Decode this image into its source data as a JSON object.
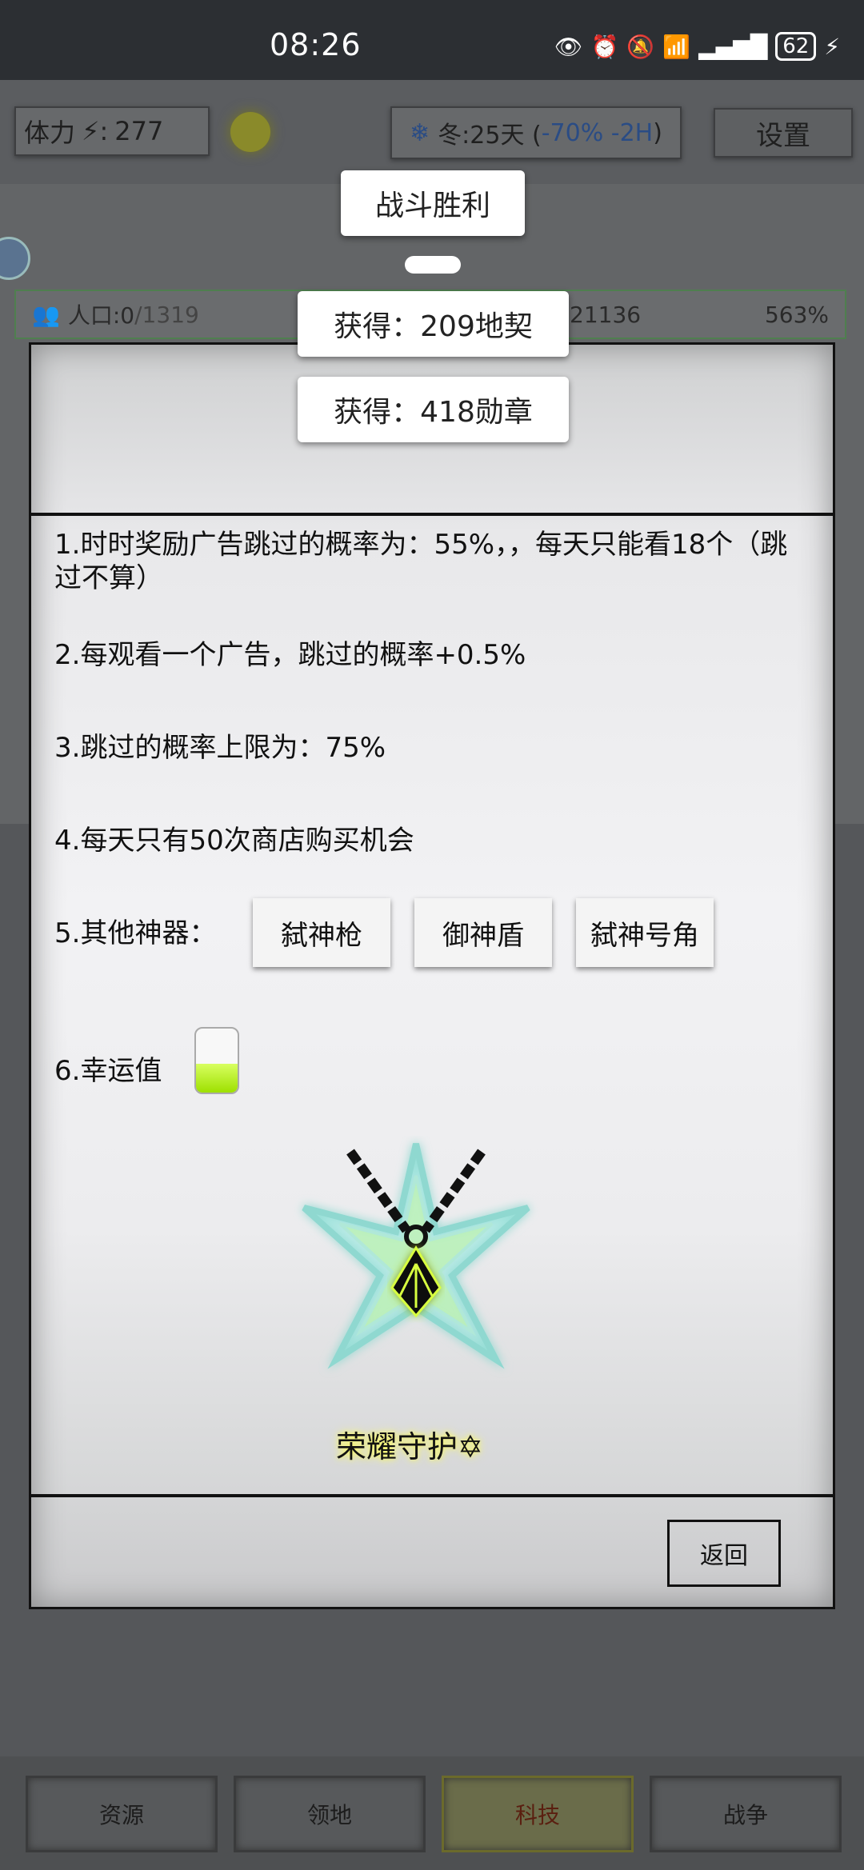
{
  "status_bar": {
    "time": "08:26",
    "battery": "62"
  },
  "header": {
    "stamina_label": "体力",
    "stamina_value": "277",
    "season_prefix": "冬:25天 (",
    "season_modifier": "-70% -2H",
    "season_suffix": ")",
    "settings_label": "设置"
  },
  "population_bar": {
    "label": "人口:0",
    "max": "/1319",
    "mid_value": "21136",
    "percent": "563%"
  },
  "toasts": {
    "battle": "战斗胜利",
    "reward1": "获得：209地契",
    "reward2": "获得：418勋章"
  },
  "rules": {
    "r1": "1.时时奖励广告跳过的概率为：55%，，每天只能看18个（跳过不算）",
    "r2": "2.每观看一个广告，跳过的概率+0.5%",
    "r3": "3.跳过的概率上限为：75%",
    "r4": "4.每天只有50次商店购买机会",
    "r5": "5.其他神器：",
    "r6": "6.幸运值"
  },
  "artifacts": [
    "弑神枪",
    "御神盾",
    "弑神号角"
  ],
  "luck_level": 0.45,
  "emblem": {
    "title": "荣耀守护",
    "icon": "star-of-david-icon",
    "glow_color": "#d8ff40"
  },
  "back_label": "返回",
  "bottom_nav": [
    "资源",
    "领地",
    "科技",
    "战争"
  ]
}
